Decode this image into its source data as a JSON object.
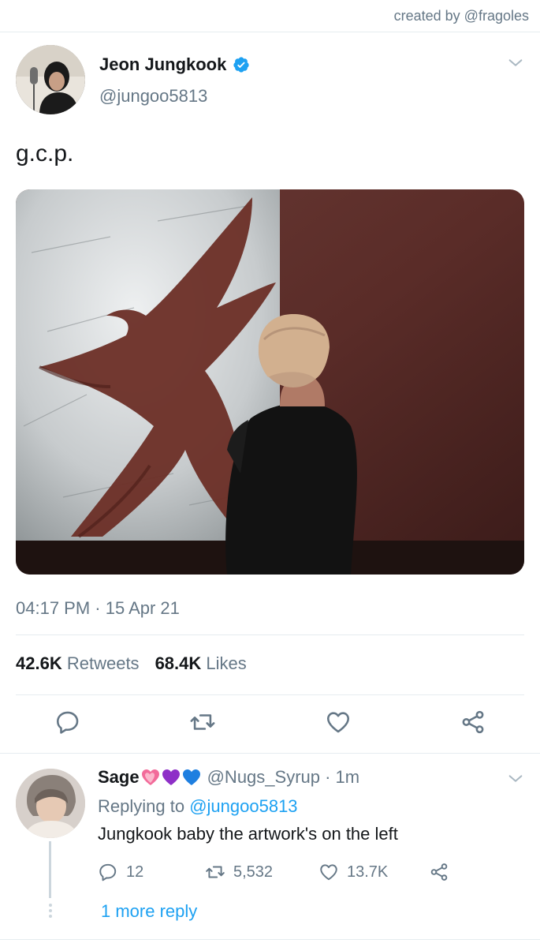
{
  "watermark": "created by @fragoles",
  "tweet": {
    "display_name": "Jeon Jungkook",
    "handle": "@jungoo5813",
    "text": "g.c.p.",
    "timestamp": "04:17 PM · 15 Apr 21",
    "retweets_count": "42.6K",
    "retweets_label": "Retweets",
    "likes_count": "68.4K",
    "likes_label": "Likes",
    "icons": {
      "verified": "verified-badge-icon",
      "more": "chevron-down-icon",
      "reply": "reply-icon",
      "retweet": "retweet-icon",
      "like": "heart-icon",
      "share": "share-icon"
    }
  },
  "reply": {
    "display_name": "Sage",
    "emojis": [
      "pink-heart-icon",
      "purple-heart-icon",
      "blue-heart-icon"
    ],
    "handle_time": "@Nugs_Syrup · 1m",
    "replying_prefix": "Replying to",
    "replying_to": "@jungoo5813",
    "text": "Jungkook baby the artwork's on the left",
    "reply_count": "12",
    "retweet_count": "5,532",
    "like_count": "13.7K",
    "more_replies": "1 more reply"
  },
  "colors": {
    "accent": "#1da1f2",
    "muted": "#657786",
    "text": "#14171a",
    "divider": "#e6ecf0"
  }
}
